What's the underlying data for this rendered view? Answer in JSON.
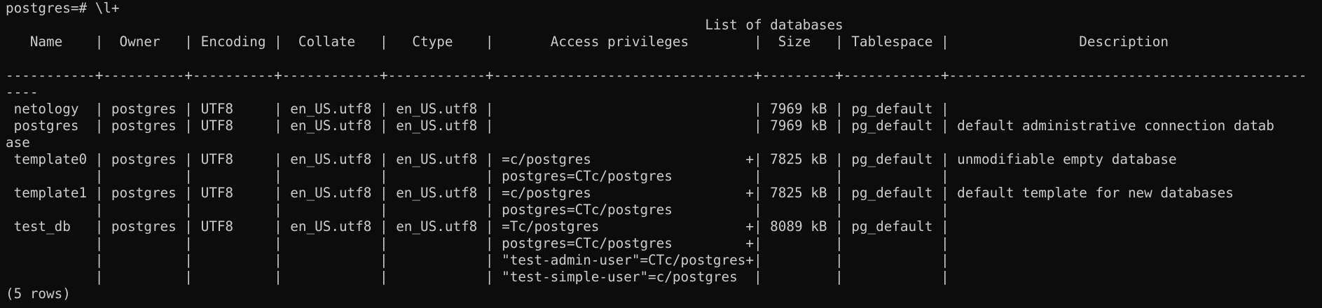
{
  "terminal": {
    "lines": [
      "postgres=# \\l+",
      "                                                                                      List of databases",
      "   Name    |  Owner   | Encoding |  Collate   |   Ctype    |       Access privileges        |  Size   | Tablespace |                Description",
      "",
      "-----------+----------+----------+------------+------------+--------------------------------+---------+------------+--------------------------------------------",
      "----",
      " netology  | postgres | UTF8     | en_US.utf8 | en_US.utf8 |                                | 7969 kB | pg_default |",
      " postgres  | postgres | UTF8     | en_US.utf8 | en_US.utf8 |                                | 7969 kB | pg_default | default administrative connection datab",
      "ase",
      " template0 | postgres | UTF8     | en_US.utf8 | en_US.utf8 | =c/postgres                   +| 7825 kB | pg_default | unmodifiable empty database",
      "           |          |          |            |            | postgres=CTc/postgres          |         |            |",
      " template1 | postgres | UTF8     | en_US.utf8 | en_US.utf8 | =c/postgres                   +| 7825 kB | pg_default | default template for new databases",
      "           |          |          |            |            | postgres=CTc/postgres          |         |            |",
      " test_db   | postgres | UTF8     | en_US.utf8 | en_US.utf8 | =Tc/postgres                  +| 8089 kB | pg_default |",
      "           |          |          |            |            | postgres=CTc/postgres         +|         |            |",
      "           |          |          |            |            | \"test-admin-user\"=CTc/postgres+|         |            |",
      "           |          |          |            |            | \"test-simple-user\"=c/postgres  |         |            |",
      "(5 rows)"
    ]
  }
}
